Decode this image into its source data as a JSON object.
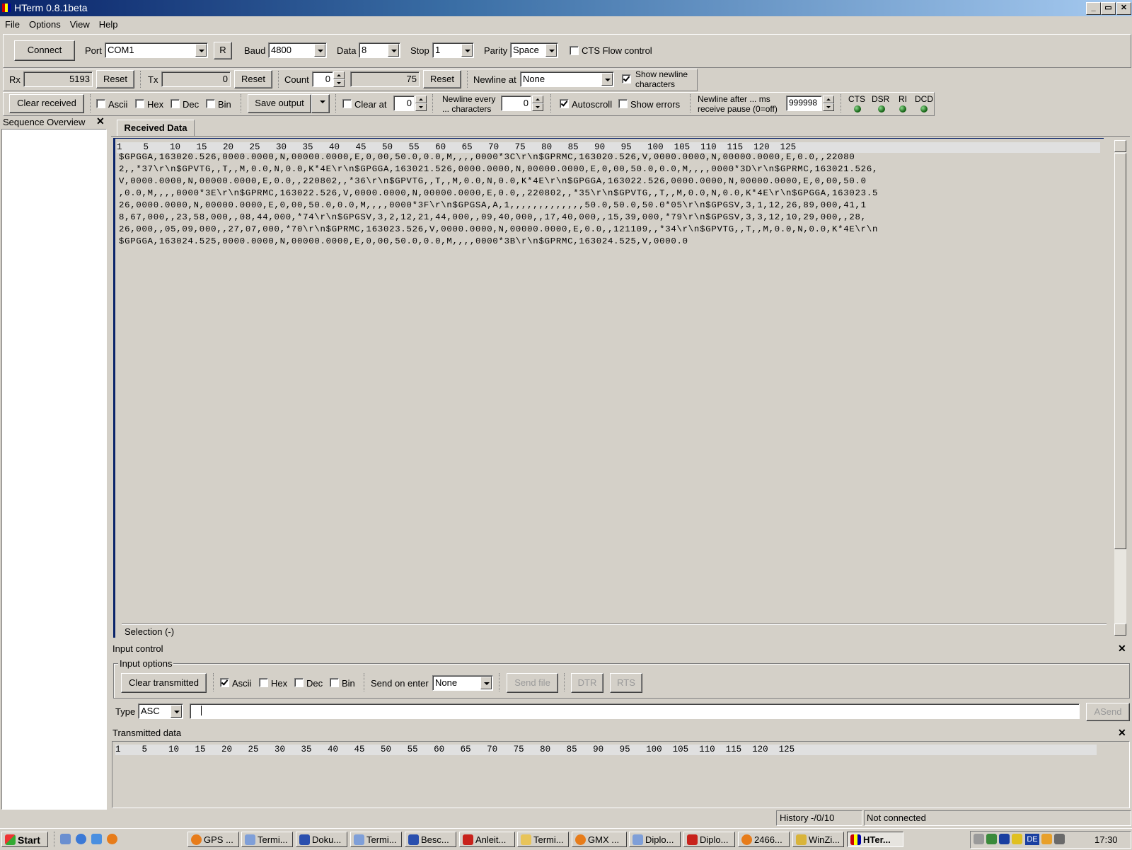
{
  "window": {
    "title": "HTerm 0.8.1beta",
    "min": "_",
    "max": "▭",
    "close": "✕"
  },
  "menu": [
    "File",
    "Options",
    "View",
    "Help"
  ],
  "connection": {
    "connect": "Connect",
    "port_label": "Port",
    "port": "COM1",
    "r": "R",
    "baud_label": "Baud",
    "baud": "4800",
    "data_label": "Data",
    "data": "8",
    "stop_label": "Stop",
    "stop": "1",
    "parity_label": "Parity",
    "parity": "Space",
    "cts_flow": "CTS Flow control"
  },
  "counters": {
    "rx_label": "Rx",
    "rx": "5193",
    "reset": "Reset",
    "tx_label": "Tx",
    "tx": "0",
    "count_label": "Count",
    "count": "0",
    "count_total": "75",
    "newline_at_label": "Newline at",
    "newline_at": "None",
    "show_newline_1": "Show newline",
    "show_newline_2": "characters"
  },
  "display": {
    "clear_received": "Clear received",
    "ascii": "Ascii",
    "hex": "Hex",
    "dec": "Dec",
    "bin": "Bin",
    "save_output": "Save output",
    "clear_at": "Clear at",
    "clear_at_value": "0",
    "newline_every_1": "Newline every",
    "newline_every_2": "... characters",
    "newline_every_value": "0",
    "autoscroll": "Autoscroll",
    "show_errors": "Show errors",
    "newline_after_1": "Newline after ... ms",
    "newline_after_2": "receive pause (0=off)",
    "newline_after_value": "999998",
    "signals": [
      "CTS",
      "DSR",
      "RI",
      "DCD"
    ]
  },
  "sequence": {
    "title": "Sequence Overview",
    "close": "✕"
  },
  "received": {
    "tab": "Received Data",
    "ruler": "1    5    10   15   20   25   30   35   40   45   50   55   60   65   70   75   80   85   90   95   100  105  110  115  120  125",
    "lines": [
      "$GPGGA,163020.526,0000.0000,N,00000.0000,E,0,00,50.0,0.0,M,,,,0000*3C\\r\\n$GPRMC,163020.526,V,0000.0000,N,00000.0000,E,0.0,,22080",
      "2,,*37\\r\\n$GPVTG,,T,,M,0.0,N,0.0,K*4E\\r\\n$GPGGA,163021.526,0000.0000,N,00000.0000,E,0,00,50.0,0.0,M,,,,0000*3D\\r\\n$GPRMC,163021.526,",
      "V,0000.0000,N,00000.0000,E,0.0,,220802,,*36\\r\\n$GPVTG,,T,,M,0.0,N,0.0,K*4E\\r\\n$GPGGA,163022.526,0000.0000,N,00000.0000,E,0,00,50.0",
      ",0.0,M,,,,0000*3E\\r\\n$GPRMC,163022.526,V,0000.0000,N,00000.0000,E,0.0,,220802,,*35\\r\\n$GPVTG,,T,,M,0.0,N,0.0,K*4E\\r\\n$GPGGA,163023.5",
      "26,0000.0000,N,00000.0000,E,0,00,50.0,0.0,M,,,,0000*3F\\r\\n$GPGSA,A,1,,,,,,,,,,,,,50.0,50.0,50.0*05\\r\\n$GPGSV,3,1,12,26,89,000,41,1",
      "8,67,000,,23,58,000,,08,44,000,*74\\r\\n$GPGSV,3,2,12,21,44,000,,09,40,000,,17,40,000,,15,39,000,*79\\r\\n$GPGSV,3,3,12,10,29,000,,28,",
      "26,000,,05,09,000,,27,07,000,*70\\r\\n$GPRMC,163023.526,V,0000.0000,N,00000.0000,E,0.0,,121109,,*34\\r\\n$GPVTG,,T,,M,0.0,N,0.0,K*4E\\r\\n",
      "$GPGGA,163024.525,0000.0000,N,00000.0000,E,0,00,50.0,0.0,M,,,,0000*3B\\r\\n$GPRMC,163024.525,V,0000.0"
    ],
    "selection": "Selection (-)"
  },
  "input": {
    "title": "Input control",
    "options": "Input options",
    "clear_transmitted": "Clear transmitted",
    "ascii": "Ascii",
    "hex": "Hex",
    "dec": "Dec",
    "bin": "Bin",
    "send_on_enter_label": "Send on enter",
    "send_on_enter": "None",
    "send_file": "Send file",
    "dtr": "DTR",
    "rts": "RTS",
    "type_label": "Type",
    "type": "ASC",
    "asend": "ASend",
    "close": "✕"
  },
  "transmitted": {
    "title": "Transmitted data",
    "close": "✕",
    "ruler": "1    5    10   15   20   25   30   35   40   45   50   55   60   65   70   75   80   85   90   95   100  105  110  115  120  125"
  },
  "status": {
    "history": "History -/0/10",
    "connection": "Not connected"
  },
  "taskbar": {
    "start": "Start",
    "tasks": [
      "GPS ...",
      "Termi...",
      "Doku...",
      "Termi...",
      "Besc...",
      "Anleit...",
      "Termi...",
      "GMX ...",
      "Diplo...",
      "Diplo...",
      "2466...",
      "WinZi...",
      "HTer..."
    ],
    "clock": "17:30",
    "lang": "DE"
  },
  "colors": {
    "title_start": "#0a246a",
    "title_end": "#a6caf0",
    "face": "#d4d0c8",
    "led": "#1a6a1a"
  }
}
